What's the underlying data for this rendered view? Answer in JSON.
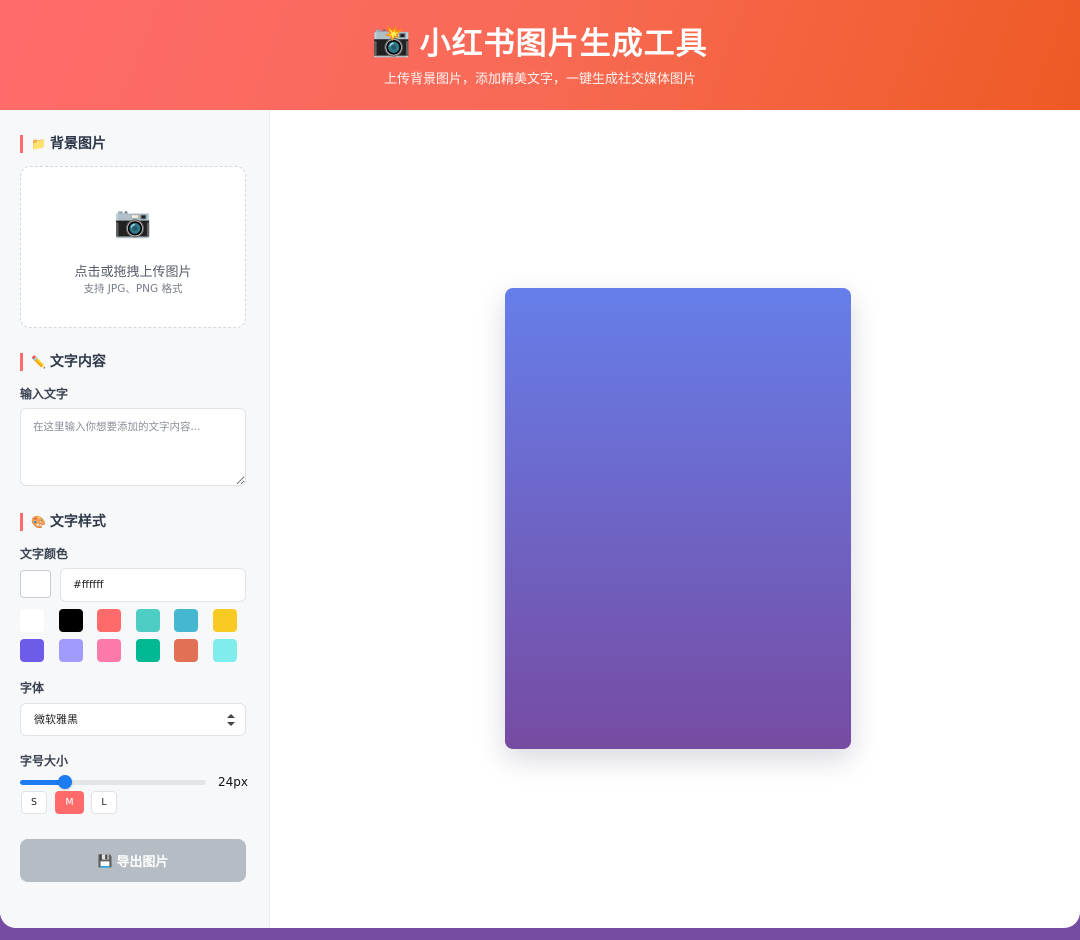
{
  "header": {
    "icon": "📸",
    "title": "小红书图片生成工具",
    "subtitle": "上传背景图片，添加精美文字，一键生成社交媒体图片"
  },
  "background_section": {
    "icon": "📁",
    "title": "背景图片",
    "upload": {
      "icon": "📷",
      "main_text": "点击或拖拽上传图片",
      "hint": "支持 JPG、PNG 格式"
    }
  },
  "text_section": {
    "icon": "✏️",
    "title": "文字内容",
    "input_label": "输入文字",
    "input_value": "",
    "input_placeholder": "在这里输入你想要添加的文字内容..."
  },
  "style_section": {
    "icon": "🎨",
    "title": "文字样式",
    "color_label": "文字颜色",
    "color_value": "#ffffff",
    "swatches": [
      "#ffffff",
      "#000000",
      "#ff6b6b",
      "#4ecdc4",
      "#45b7d1",
      "#f9ca24",
      "#6c5ce7",
      "#a29bfe",
      "#fd79a8",
      "#00b894",
      "#e17055",
      "#81ecec"
    ],
    "font_label": "字体",
    "font_value": "微软雅黑",
    "size_label": "字号大小",
    "size_value": "24px",
    "size_fraction": 0.24,
    "size_buttons": [
      "S",
      "M",
      "L"
    ],
    "active_size": "M"
  },
  "export": {
    "icon": "💾",
    "label": "导出图片"
  },
  "canvas": {
    "gradient_top": "#667eea",
    "gradient_bottom": "#764ba2"
  },
  "colors": {
    "accent": "#ff6b6b",
    "header_end": "#ee5a24",
    "slider": "#1d7cf2",
    "export_disabled": "#b5bcc4"
  }
}
